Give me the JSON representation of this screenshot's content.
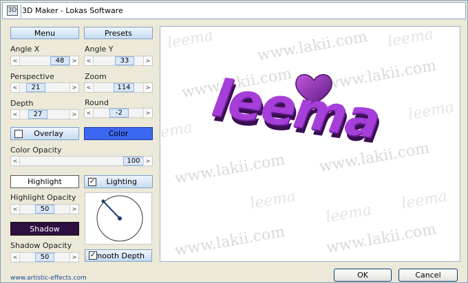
{
  "window": {
    "title": "3D Maker - Lokas Software",
    "icon": "app-icon"
  },
  "buttons": {
    "menu": "Menu",
    "presets": "Presets",
    "overlay": "Overlay",
    "color": "Color",
    "highlight": "Highlight",
    "lighting": "Lighting",
    "shadow": "Shadow",
    "smooth_depth": "Smooth Depth",
    "ok": "OK",
    "cancel": "Cancel"
  },
  "controls": {
    "angle_x": {
      "label": "Angle X",
      "value": "48"
    },
    "angle_y": {
      "label": "Angle Y",
      "value": "33"
    },
    "perspective": {
      "label": "Perspective",
      "value": "21"
    },
    "zoom": {
      "label": "Zoom",
      "value": "114"
    },
    "depth": {
      "label": "Depth",
      "value": "27"
    },
    "round": {
      "label": "Round",
      "value": "-2"
    },
    "color_opacity": {
      "label": "Color Opacity",
      "value": "100"
    },
    "highlight_opacity": {
      "label": "Highlight Opacity",
      "value": "50"
    },
    "shadow_opacity": {
      "label": "Shadow Opacity",
      "value": "50"
    }
  },
  "checkboxes": {
    "overlay": false,
    "lighting": true,
    "smooth_depth": true
  },
  "colors": {
    "color_button": "#3c67f0",
    "shadow_button": "#2e0f3f",
    "text_purple": "#8a2bc2"
  },
  "preview": {
    "text": "leema",
    "watermarks": [
      "www.lakii.com",
      "leema"
    ]
  },
  "footer": {
    "link": "www.artistic-effects.com"
  }
}
